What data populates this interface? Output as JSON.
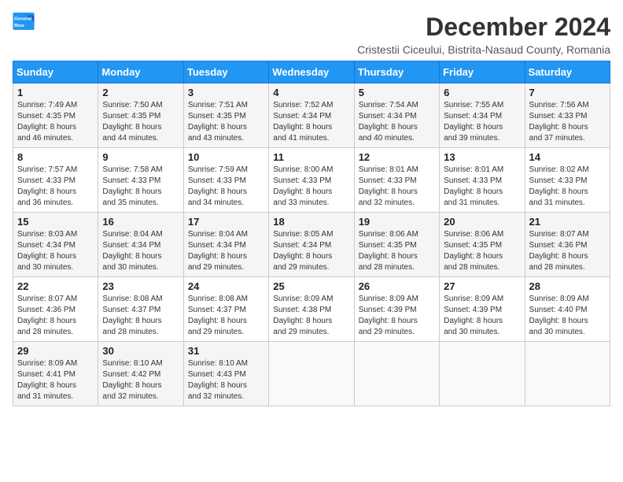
{
  "header": {
    "logo_line1": "General",
    "logo_line2": "Blue",
    "month_title": "December 2024",
    "subtitle": "Cristestii Ciceului, Bistrita-Nasaud County, Romania"
  },
  "weekdays": [
    "Sunday",
    "Monday",
    "Tuesday",
    "Wednesday",
    "Thursday",
    "Friday",
    "Saturday"
  ],
  "weeks": [
    [
      {
        "day": "1",
        "info": "Sunrise: 7:49 AM\nSunset: 4:35 PM\nDaylight: 8 hours\nand 46 minutes."
      },
      {
        "day": "2",
        "info": "Sunrise: 7:50 AM\nSunset: 4:35 PM\nDaylight: 8 hours\nand 44 minutes."
      },
      {
        "day": "3",
        "info": "Sunrise: 7:51 AM\nSunset: 4:35 PM\nDaylight: 8 hours\nand 43 minutes."
      },
      {
        "day": "4",
        "info": "Sunrise: 7:52 AM\nSunset: 4:34 PM\nDaylight: 8 hours\nand 41 minutes."
      },
      {
        "day": "5",
        "info": "Sunrise: 7:54 AM\nSunset: 4:34 PM\nDaylight: 8 hours\nand 40 minutes."
      },
      {
        "day": "6",
        "info": "Sunrise: 7:55 AM\nSunset: 4:34 PM\nDaylight: 8 hours\nand 39 minutes."
      },
      {
        "day": "7",
        "info": "Sunrise: 7:56 AM\nSunset: 4:33 PM\nDaylight: 8 hours\nand 37 minutes."
      }
    ],
    [
      {
        "day": "8",
        "info": "Sunrise: 7:57 AM\nSunset: 4:33 PM\nDaylight: 8 hours\nand 36 minutes."
      },
      {
        "day": "9",
        "info": "Sunrise: 7:58 AM\nSunset: 4:33 PM\nDaylight: 8 hours\nand 35 minutes."
      },
      {
        "day": "10",
        "info": "Sunrise: 7:59 AM\nSunset: 4:33 PM\nDaylight: 8 hours\nand 34 minutes."
      },
      {
        "day": "11",
        "info": "Sunrise: 8:00 AM\nSunset: 4:33 PM\nDaylight: 8 hours\nand 33 minutes."
      },
      {
        "day": "12",
        "info": "Sunrise: 8:01 AM\nSunset: 4:33 PM\nDaylight: 8 hours\nand 32 minutes."
      },
      {
        "day": "13",
        "info": "Sunrise: 8:01 AM\nSunset: 4:33 PM\nDaylight: 8 hours\nand 31 minutes."
      },
      {
        "day": "14",
        "info": "Sunrise: 8:02 AM\nSunset: 4:33 PM\nDaylight: 8 hours\nand 31 minutes."
      }
    ],
    [
      {
        "day": "15",
        "info": "Sunrise: 8:03 AM\nSunset: 4:34 PM\nDaylight: 8 hours\nand 30 minutes."
      },
      {
        "day": "16",
        "info": "Sunrise: 8:04 AM\nSunset: 4:34 PM\nDaylight: 8 hours\nand 30 minutes."
      },
      {
        "day": "17",
        "info": "Sunrise: 8:04 AM\nSunset: 4:34 PM\nDaylight: 8 hours\nand 29 minutes."
      },
      {
        "day": "18",
        "info": "Sunrise: 8:05 AM\nSunset: 4:34 PM\nDaylight: 8 hours\nand 29 minutes."
      },
      {
        "day": "19",
        "info": "Sunrise: 8:06 AM\nSunset: 4:35 PM\nDaylight: 8 hours\nand 28 minutes."
      },
      {
        "day": "20",
        "info": "Sunrise: 8:06 AM\nSunset: 4:35 PM\nDaylight: 8 hours\nand 28 minutes."
      },
      {
        "day": "21",
        "info": "Sunrise: 8:07 AM\nSunset: 4:36 PM\nDaylight: 8 hours\nand 28 minutes."
      }
    ],
    [
      {
        "day": "22",
        "info": "Sunrise: 8:07 AM\nSunset: 4:36 PM\nDaylight: 8 hours\nand 28 minutes."
      },
      {
        "day": "23",
        "info": "Sunrise: 8:08 AM\nSunset: 4:37 PM\nDaylight: 8 hours\nand 28 minutes."
      },
      {
        "day": "24",
        "info": "Sunrise: 8:08 AM\nSunset: 4:37 PM\nDaylight: 8 hours\nand 29 minutes."
      },
      {
        "day": "25",
        "info": "Sunrise: 8:09 AM\nSunset: 4:38 PM\nDaylight: 8 hours\nand 29 minutes."
      },
      {
        "day": "26",
        "info": "Sunrise: 8:09 AM\nSunset: 4:39 PM\nDaylight: 8 hours\nand 29 minutes."
      },
      {
        "day": "27",
        "info": "Sunrise: 8:09 AM\nSunset: 4:39 PM\nDaylight: 8 hours\nand 30 minutes."
      },
      {
        "day": "28",
        "info": "Sunrise: 8:09 AM\nSunset: 4:40 PM\nDaylight: 8 hours\nand 30 minutes."
      }
    ],
    [
      {
        "day": "29",
        "info": "Sunrise: 8:09 AM\nSunset: 4:41 PM\nDaylight: 8 hours\nand 31 minutes."
      },
      {
        "day": "30",
        "info": "Sunrise: 8:10 AM\nSunset: 4:42 PM\nDaylight: 8 hours\nand 32 minutes."
      },
      {
        "day": "31",
        "info": "Sunrise: 8:10 AM\nSunset: 4:43 PM\nDaylight: 8 hours\nand 32 minutes."
      },
      null,
      null,
      null,
      null
    ]
  ]
}
